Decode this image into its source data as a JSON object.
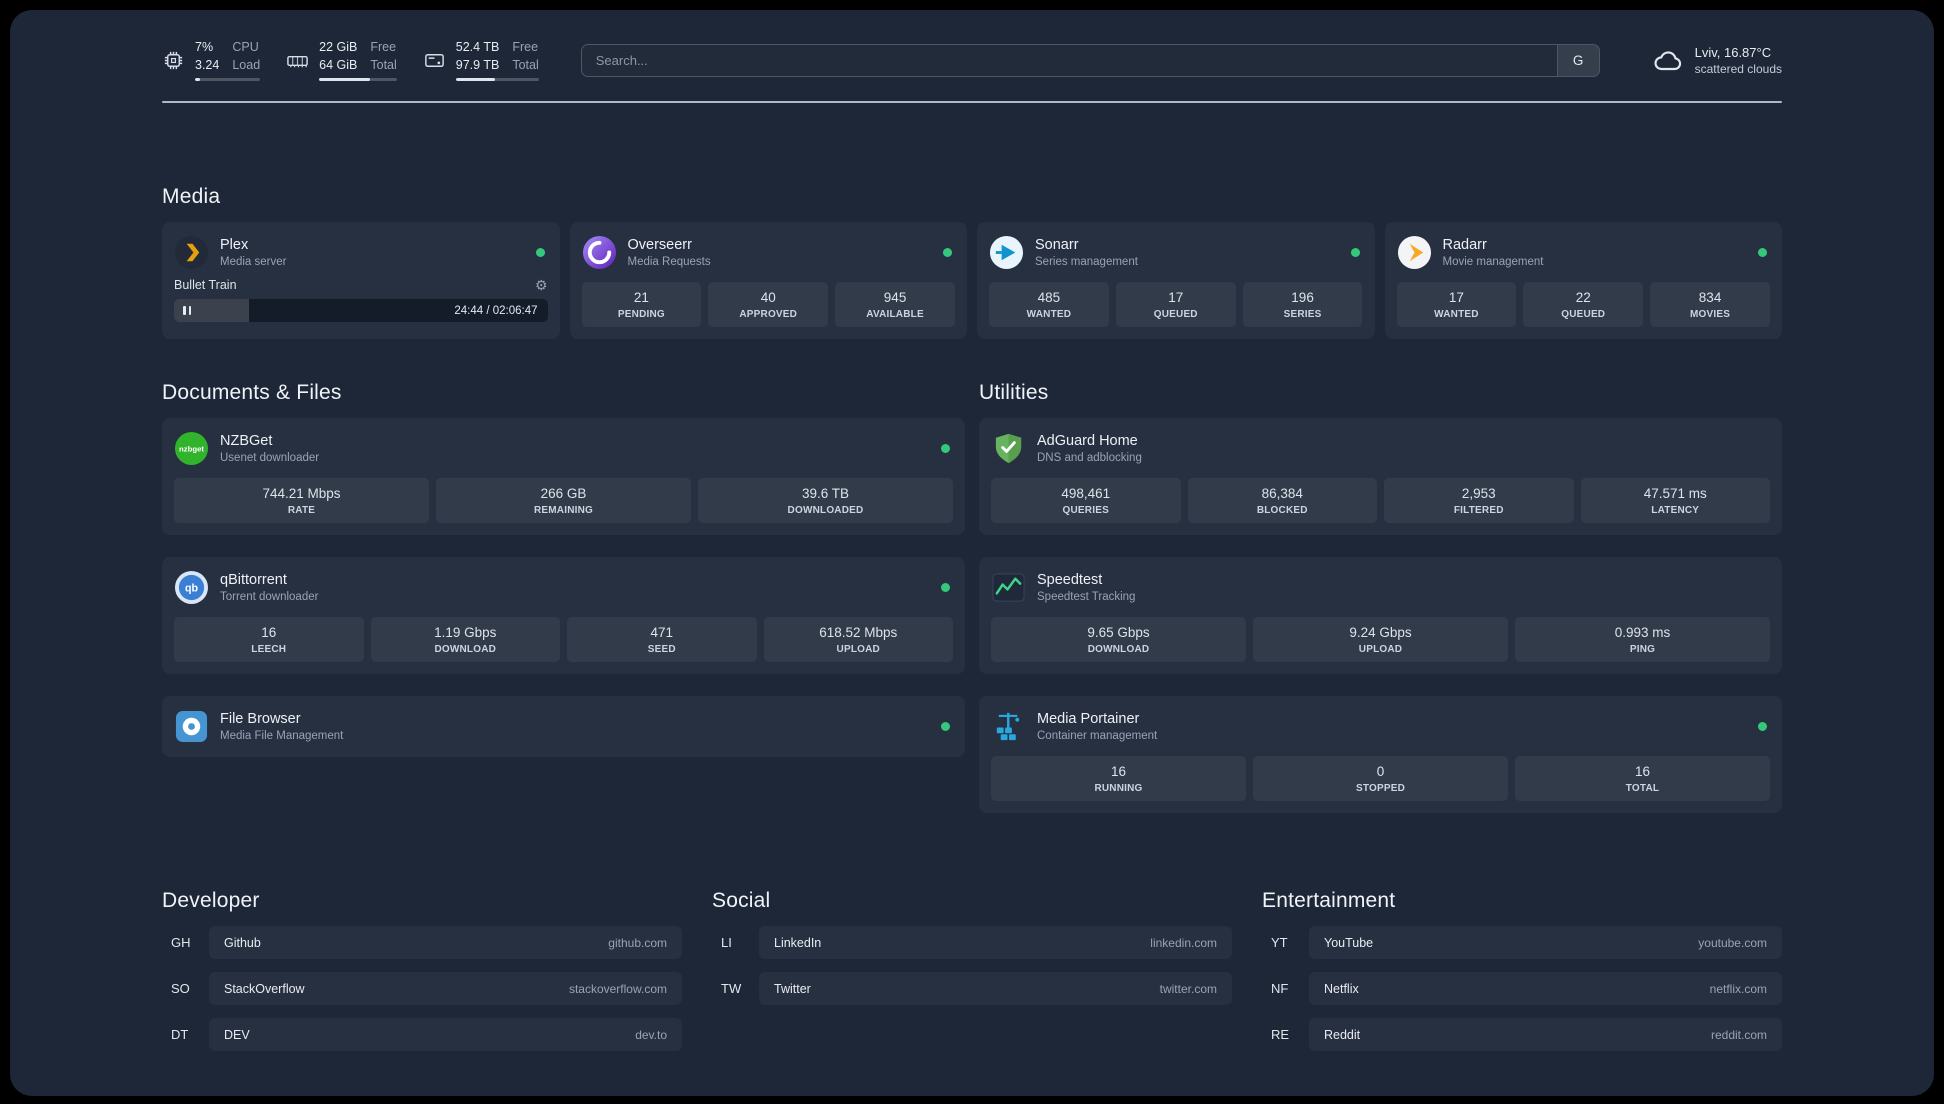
{
  "colors": {
    "status_green": "#34c97a",
    "page_bg": "#1e2737",
    "card_bg": "#273040"
  },
  "header": {
    "cpu": {
      "icon": "cpu-chip-icon",
      "value_top": "7%",
      "value_bottom": "3.24",
      "label_top": "CPU",
      "label_bottom": "Load",
      "bar_percent": 7
    },
    "ram": {
      "icon": "memory-icon",
      "value_top": "22 GiB",
      "value_bottom": "64 GiB",
      "label_top": "Free",
      "label_bottom": "Total",
      "bar_percent": 66
    },
    "disk": {
      "icon": "hard-disk-icon",
      "value_top": "52.4 TB",
      "value_bottom": "97.9 TB",
      "label_top": "Free",
      "label_bottom": "Total",
      "bar_percent": 47
    },
    "search": {
      "placeholder": "Search...",
      "provider_label": "G"
    },
    "weather": {
      "icon": "cloud-icon",
      "location": "Lviv, 16.87°C",
      "condition": "scattered clouds"
    }
  },
  "media": {
    "title": "Media",
    "cards": [
      {
        "id": "plex",
        "title": "Plex",
        "subtitle": "Media server",
        "status": "online",
        "player": {
          "track": "Bullet Train",
          "time": "24:44 / 02:06:47",
          "progress_percent": 20
        }
      },
      {
        "id": "overseerr",
        "title": "Overseerr",
        "subtitle": "Media Requests",
        "status": "online",
        "stats": [
          {
            "value": "21",
            "label": "PENDING"
          },
          {
            "value": "40",
            "label": "APPROVED"
          },
          {
            "value": "945",
            "label": "AVAILABLE"
          }
        ]
      },
      {
        "id": "sonarr",
        "title": "Sonarr",
        "subtitle": "Series management",
        "status": "online",
        "stats": [
          {
            "value": "485",
            "label": "WANTED"
          },
          {
            "value": "17",
            "label": "QUEUED"
          },
          {
            "value": "196",
            "label": "SERIES"
          }
        ]
      },
      {
        "id": "radarr",
        "title": "Radarr",
        "subtitle": "Movie management",
        "status": "online",
        "stats": [
          {
            "value": "17",
            "label": "WANTED"
          },
          {
            "value": "22",
            "label": "QUEUED"
          },
          {
            "value": "834",
            "label": "MOVIES"
          }
        ]
      }
    ]
  },
  "documents": {
    "title": "Documents & Files",
    "cards": [
      {
        "id": "nzbget",
        "title": "NZBGet",
        "subtitle": "Usenet downloader",
        "status": "online",
        "stats": [
          {
            "value": "744.21 Mbps",
            "label": "RATE"
          },
          {
            "value": "266 GB",
            "label": "REMAINING"
          },
          {
            "value": "39.6 TB",
            "label": "DOWNLOADED"
          }
        ]
      },
      {
        "id": "qbittorrent",
        "title": "qBittorrent",
        "subtitle": "Torrent downloader",
        "status": "online",
        "stats": [
          {
            "value": "16",
            "label": "LEECH"
          },
          {
            "value": "1.19 Gbps",
            "label": "DOWNLOAD"
          },
          {
            "value": "471",
            "label": "SEED"
          },
          {
            "value": "618.52 Mbps",
            "label": "UPLOAD"
          }
        ]
      },
      {
        "id": "filebrowser",
        "title": "File Browser",
        "subtitle": "Media File Management",
        "status": "online"
      }
    ]
  },
  "utilities": {
    "title": "Utilities",
    "cards": [
      {
        "id": "adguard",
        "title": "AdGuard Home",
        "subtitle": "DNS and adblocking",
        "stats": [
          {
            "value": "498,461",
            "label": "QUERIES"
          },
          {
            "value": "86,384",
            "label": "BLOCKED"
          },
          {
            "value": "2,953",
            "label": "FILTERED"
          },
          {
            "value": "47.571 ms",
            "label": "LATENCY"
          }
        ]
      },
      {
        "id": "speedtest",
        "title": "Speedtest",
        "subtitle": "Speedtest Tracking",
        "stats": [
          {
            "value": "9.65 Gbps",
            "label": "DOWNLOAD"
          },
          {
            "value": "9.24 Gbps",
            "label": "UPLOAD"
          },
          {
            "value": "0.993 ms",
            "label": "PING"
          }
        ]
      },
      {
        "id": "portainer",
        "title": "Media Portainer",
        "subtitle": "Container management",
        "status": "online",
        "stats": [
          {
            "value": "16",
            "label": "RUNNING"
          },
          {
            "value": "0",
            "label": "STOPPED"
          },
          {
            "value": "16",
            "label": "TOTAL"
          }
        ]
      }
    ]
  },
  "bookmarks": [
    {
      "title": "Developer",
      "items": [
        {
          "abbr": "GH",
          "name": "Github",
          "url": "github.com"
        },
        {
          "abbr": "SO",
          "name": "StackOverflow",
          "url": "stackoverflow.com"
        },
        {
          "abbr": "DT",
          "name": "DEV",
          "url": "dev.to"
        }
      ]
    },
    {
      "title": "Social",
      "items": [
        {
          "abbr": "LI",
          "name": "LinkedIn",
          "url": "linkedin.com"
        },
        {
          "abbr": "TW",
          "name": "Twitter",
          "url": "twitter.com"
        }
      ]
    },
    {
      "title": "Entertainment",
      "items": [
        {
          "abbr": "YT",
          "name": "YouTube",
          "url": "youtube.com"
        },
        {
          "abbr": "NF",
          "name": "Netflix",
          "url": "netflix.com"
        },
        {
          "abbr": "RE",
          "name": "Reddit",
          "url": "reddit.com"
        }
      ]
    }
  ]
}
